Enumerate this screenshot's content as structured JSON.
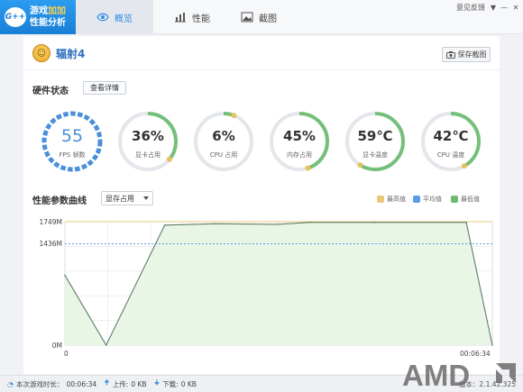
{
  "app": {
    "logo_badge": "G++",
    "logo_line1": "游戏",
    "logo_line1_accent": "加加",
    "logo_line2": "性能分析"
  },
  "nav": {
    "tabs": [
      {
        "label": "概览",
        "icon": "eye-icon",
        "active": true
      },
      {
        "label": "性能",
        "icon": "bar-chart-icon",
        "active": false
      },
      {
        "label": "截图",
        "icon": "image-icon",
        "active": false
      }
    ]
  },
  "window": {
    "feedback": "意见反馈",
    "dropdown": "▼",
    "minimize": "—",
    "close": "✕"
  },
  "game": {
    "title": "辐射4",
    "screenshot_label": "保存截图",
    "icon": "game-avatar-icon"
  },
  "hardware": {
    "title": "硬件状态",
    "detail_label": "查看详情"
  },
  "gauges": [
    {
      "value": "55",
      "label": "FPS 帧数",
      "fill": 0.8,
      "color": "#4a8fdb",
      "dashed": true
    },
    {
      "value": "36%",
      "label": "显卡占用",
      "fill": 0.36
    },
    {
      "value": "6%",
      "label": "CPU 占用",
      "fill": 0.06
    },
    {
      "value": "45%",
      "label": "内存占用",
      "fill": 0.45
    },
    {
      "value": "59℃",
      "label": "显卡温度",
      "fill": 0.59
    },
    {
      "value": "42℃",
      "label": "CPU 温度",
      "fill": 0.42
    }
  ],
  "chart_section": {
    "title": "性能参数曲线",
    "selected_metric": "显存占用",
    "legend": [
      {
        "label": "最高值",
        "color": "#e8c97a"
      },
      {
        "label": "平均值",
        "color": "#5b9be3"
      },
      {
        "label": "最低值",
        "color": "#6dbb6d"
      }
    ]
  },
  "chart_data": {
    "type": "area",
    "y_unit": "M",
    "ylim": [
      0,
      1749
    ],
    "y_ticks": [
      "1749M",
      "1436M",
      "0M"
    ],
    "x_ticks": [
      "0",
      "00:06:34"
    ],
    "xlim": [
      0,
      394
    ],
    "max_value": 1749,
    "avg_value": 1436,
    "series": [
      {
        "x": [
          0,
          38,
          92,
          139,
          196,
          225,
          285,
          370,
          394
        ],
        "values": [
          990,
          0,
          1700,
          1720,
          1712,
          1738,
          1738,
          1738,
          0
        ]
      }
    ],
    "grid": true
  },
  "status": {
    "play_time_label": "本次游戏时长：",
    "play_time": "00:06:34",
    "upload_label": "上传:",
    "upload_value": "0 KB",
    "download_label": "下载:",
    "download_value": "0 KB",
    "version": "版本：2.1.42.325"
  },
  "watermark": {
    "text": "AMD"
  }
}
